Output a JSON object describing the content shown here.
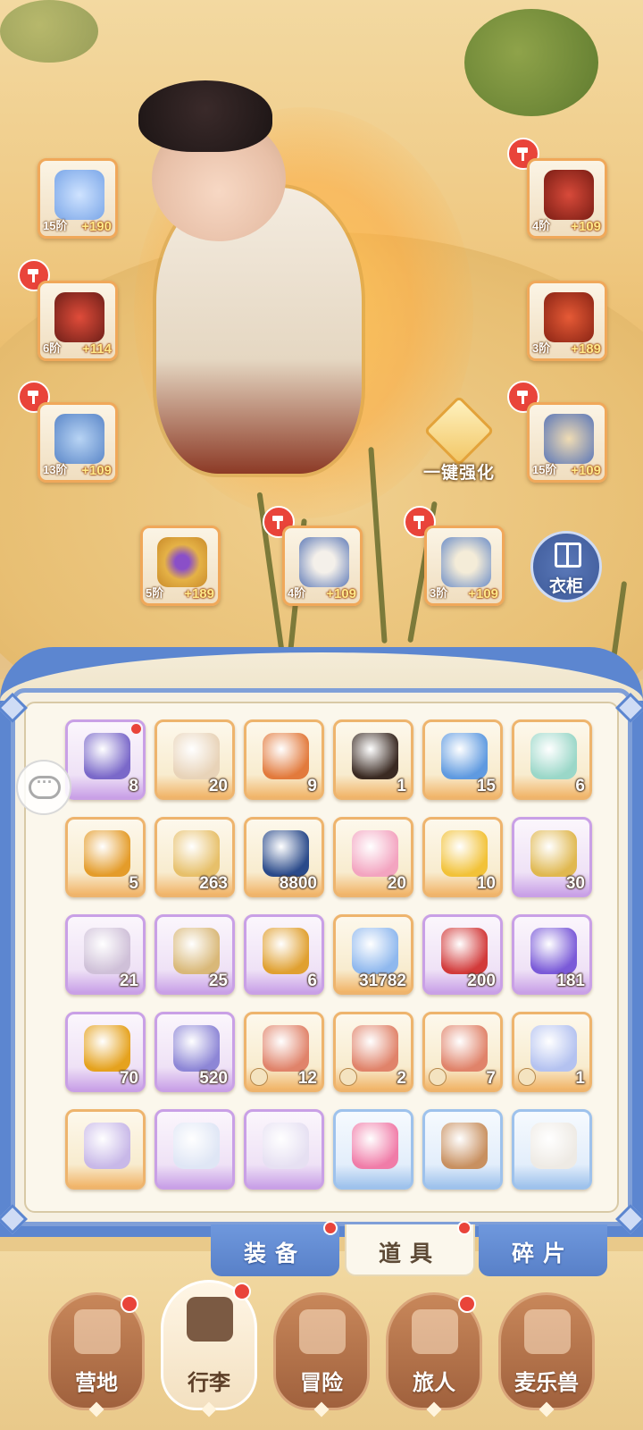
{
  "equipment": {
    "weapon": {
      "tier": "15阶",
      "plus": "+190",
      "icon": "halberd-icon"
    },
    "helmet": {
      "tier": "4阶",
      "plus": "+109",
      "icon": "helmet-icon"
    },
    "armor": {
      "tier": "6阶",
      "plus": "+114",
      "icon": "armor-icon"
    },
    "gloves": {
      "tier": "3阶",
      "plus": "+189",
      "icon": "gauntlet-icon"
    },
    "pants": {
      "tier": "13阶",
      "plus": "+109",
      "icon": "greaves-icon"
    },
    "boots": {
      "tier": "15阶",
      "plus": "+109",
      "icon": "boots-icon"
    },
    "ring": {
      "tier": "5阶",
      "plus": "+189",
      "icon": "ring-icon"
    },
    "necklace": {
      "tier": "4阶",
      "plus": "+109",
      "icon": "necklace-icon"
    },
    "pendant": {
      "tier": "3阶",
      "plus": "+109",
      "icon": "pendant-icon"
    }
  },
  "upgrade_all_label": "一键强化",
  "wardrobe_label": "衣柜",
  "items": [
    {
      "qty": "8",
      "rarity": "purple",
      "icon": "scroll-icon",
      "color": "#7a68c9",
      "badge": true
    },
    {
      "qty": "20",
      "rarity": "orange",
      "icon": "goat-icon",
      "color": "#e8d3b8"
    },
    {
      "qty": "9",
      "rarity": "orange",
      "icon": "cat-bag-icon",
      "color": "#e27a3c"
    },
    {
      "qty": "1",
      "rarity": "orange",
      "icon": "crossbow-icon",
      "color": "#3a2a22"
    },
    {
      "qty": "15",
      "rarity": "orange",
      "icon": "paper-plane-icon",
      "color": "#5f9ae0"
    },
    {
      "qty": "6",
      "rarity": "orange",
      "icon": "rainbow-crystal-icon",
      "color": "#9ad7c8"
    },
    {
      "qty": "5",
      "rarity": "orange",
      "icon": "amber-orb-icon",
      "color": "#e49c2a"
    },
    {
      "qty": "263",
      "rarity": "orange",
      "icon": "lyre-icon",
      "color": "#e7c06a"
    },
    {
      "qty": "8800",
      "rarity": "orange",
      "icon": "blue-coin-icon",
      "color": "#2a4a8a"
    },
    {
      "qty": "20",
      "rarity": "orange",
      "icon": "rainbow-paint-icon",
      "color": "#f3a4c0"
    },
    {
      "qty": "10",
      "rarity": "orange",
      "icon": "golden-paint-icon",
      "color": "#f2c238"
    },
    {
      "qty": "30",
      "rarity": "purple",
      "icon": "pudding-icon",
      "color": "#e0b850"
    },
    {
      "qty": "21",
      "rarity": "purple",
      "icon": "spoon-icon",
      "color": "#cfc0d8"
    },
    {
      "qty": "25",
      "rarity": "purple",
      "icon": "paw-sack-icon",
      "color": "#d9b878"
    },
    {
      "qty": "6",
      "rarity": "purple",
      "icon": "horseshoe-icon",
      "color": "#e0a030"
    },
    {
      "qty": "31782",
      "rarity": "orange",
      "icon": "star-crystal-icon",
      "color": "#8fb8ee"
    },
    {
      "qty": "200",
      "rarity": "purple",
      "icon": "magnet-icon",
      "color": "#d23a3a"
    },
    {
      "qty": "181",
      "rarity": "purple",
      "icon": "amethyst-icon",
      "color": "#7a5ad8"
    },
    {
      "qty": "70",
      "rarity": "purple",
      "icon": "gold-gem-icon",
      "color": "#e5a21e"
    },
    {
      "qty": "520",
      "rarity": "purple",
      "icon": "heart-coin-icon",
      "color": "#8d86d6"
    },
    {
      "qty": "12",
      "rarity": "orange",
      "icon": "ember-crystal-icon",
      "color": "#e0836a",
      "tag": true
    },
    {
      "qty": "2",
      "rarity": "orange",
      "icon": "ember-crystal-icon",
      "color": "#e0836a",
      "tag": true
    },
    {
      "qty": "7",
      "rarity": "orange",
      "icon": "ember-crystal-icon",
      "color": "#e0836a",
      "tag": true
    },
    {
      "qty": "1",
      "rarity": "orange",
      "icon": "ice-crystal-icon",
      "color": "#b4c2f0",
      "tag": true
    },
    {
      "qty": "",
      "rarity": "orange",
      "icon": "item-icon",
      "color": "#c8b8e8"
    },
    {
      "qty": "",
      "rarity": "purple",
      "icon": "potion-icon",
      "color": "#dfe6f5"
    },
    {
      "qty": "",
      "rarity": "purple",
      "icon": "item-icon",
      "color": "#e6e0f2"
    },
    {
      "qty": "",
      "rarity": "blue",
      "icon": "pink-flower-icon",
      "color": "#f07ca8"
    },
    {
      "qty": "",
      "rarity": "blue",
      "icon": "paw-icon",
      "color": "#c89060"
    },
    {
      "qty": "",
      "rarity": "blue",
      "icon": "item-icon",
      "color": "#eeeae4"
    }
  ],
  "tabs": [
    {
      "label": "装备",
      "active": false,
      "badge": true
    },
    {
      "label": "道具",
      "active": true,
      "badge": true
    },
    {
      "label": "碎片",
      "active": false,
      "badge": false
    }
  ],
  "nav": [
    {
      "label": "营地",
      "icon": "castle-icon",
      "badge": true,
      "active": false
    },
    {
      "label": "行李",
      "icon": "backpack-icon",
      "badge": true,
      "active": true
    },
    {
      "label": "冒险",
      "icon": "crossed-swords-icon",
      "badge": false,
      "active": false
    },
    {
      "label": "旅人",
      "icon": "traveler-icon",
      "badge": true,
      "active": false
    },
    {
      "label": "麦乐兽",
      "icon": "cat-icon",
      "badge": false,
      "active": false
    }
  ],
  "colors": {
    "accent_blue": "#5c86d0",
    "badge_red": "#e9443a",
    "panel_bg": "#fbf7ec"
  }
}
